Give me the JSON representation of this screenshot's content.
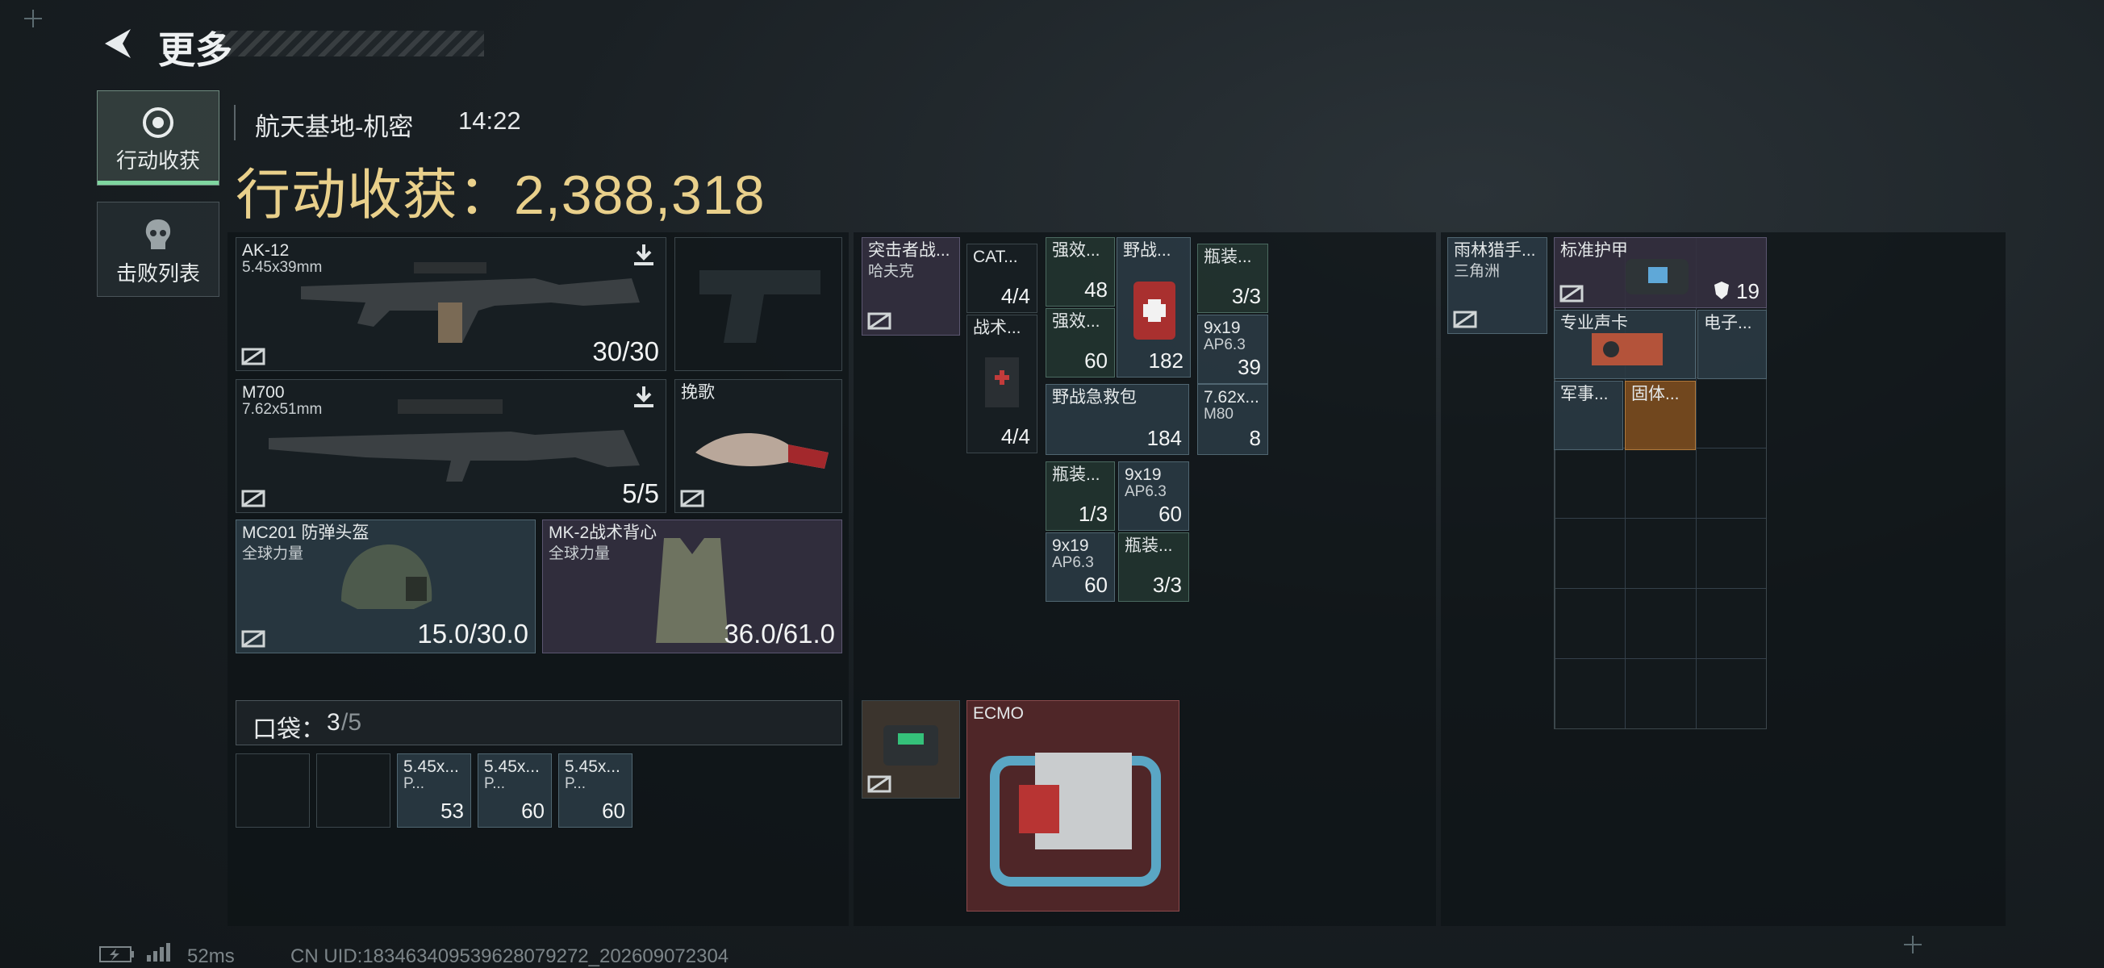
{
  "header": {
    "title": "更多"
  },
  "nav": [
    {
      "label": "行动收获",
      "active": true,
      "icon": "loot-icon"
    },
    {
      "label": "击败列表",
      "active": false,
      "icon": "skull-icon"
    }
  ],
  "info": {
    "map": "航天基地-机密",
    "time": "14:22",
    "gain": "行动收获：2,388,318"
  },
  "gear": {
    "weapon1": {
      "name": "AK-12",
      "caliber": "5.45x39mm",
      "ammo": "30/30"
    },
    "weapon2": {
      "name": "M700",
      "caliber": "7.62x51mm",
      "ammo": "5/5"
    },
    "melee": {
      "name": "挽歌"
    },
    "helmet": {
      "name": "MC201 防弹头盔",
      "faction": "全球力量",
      "durability": "15.0/30.0"
    },
    "armor": {
      "name": "MK-2战术背心",
      "faction": "全球力量",
      "durability": "36.0/61.0"
    }
  },
  "pocket": {
    "label": "口袋：",
    "count": "3",
    "capacity": "/5",
    "items": [
      {
        "name": "5.45x...",
        "sub": "P...",
        "qty": "53"
      },
      {
        "name": "5.45x...",
        "sub": "P...",
        "qty": "60"
      },
      {
        "name": "5.45x...",
        "sub": "P...",
        "qty": "60"
      }
    ]
  },
  "backpack": {
    "rig": {
      "name": "突击者战...",
      "sub": "哈夫克"
    },
    "cat": {
      "name": "CAT...",
      "qty": "4/4"
    },
    "tactical": {
      "name": "战术...",
      "qty": "4/4"
    },
    "stim1": {
      "name": "强效...",
      "qty": "48"
    },
    "stim2": {
      "name": "强效...",
      "qty": "60"
    },
    "kit_small": {
      "name": "野战...",
      "qty": "182"
    },
    "kit_big": {
      "name": "野战急救包",
      "qty": "184"
    },
    "bottle1": {
      "name": "瓶装...",
      "qty": "3/3"
    },
    "ammo_a": {
      "name": "9x19",
      "sub": "AP6.3",
      "qty": "39"
    },
    "ammo_m": {
      "name": "7.62x...",
      "sub": "M80",
      "qty": "8"
    },
    "bottle2": {
      "name": "瓶装...",
      "qty": "1/3"
    },
    "ammo_b": {
      "name": "9x19",
      "sub": "AP6.3",
      "qty": "60"
    },
    "ammo_c": {
      "name": "9x19",
      "sub": "AP6.3",
      "qty": "60"
    },
    "bottle3": {
      "name": "瓶装...",
      "qty": "3/3"
    },
    "ecmo": {
      "name": "ECMO"
    }
  },
  "stash": {
    "rain": {
      "name": "雨林猎手...",
      "sub": "三角洲"
    },
    "armor": {
      "name": "标准护甲",
      "qty": "19"
    },
    "card": {
      "name": "专业声卡"
    },
    "elec": {
      "name": "电子..."
    },
    "mil": {
      "name": "军事..."
    },
    "solid": {
      "name": "固体..."
    }
  },
  "footer": {
    "ping": "52ms",
    "uid": "CN UID:1834634095396280792​72_202609072304"
  },
  "colors": {
    "gain": "#e9d08b",
    "active_tab": "#7fd6a0"
  }
}
